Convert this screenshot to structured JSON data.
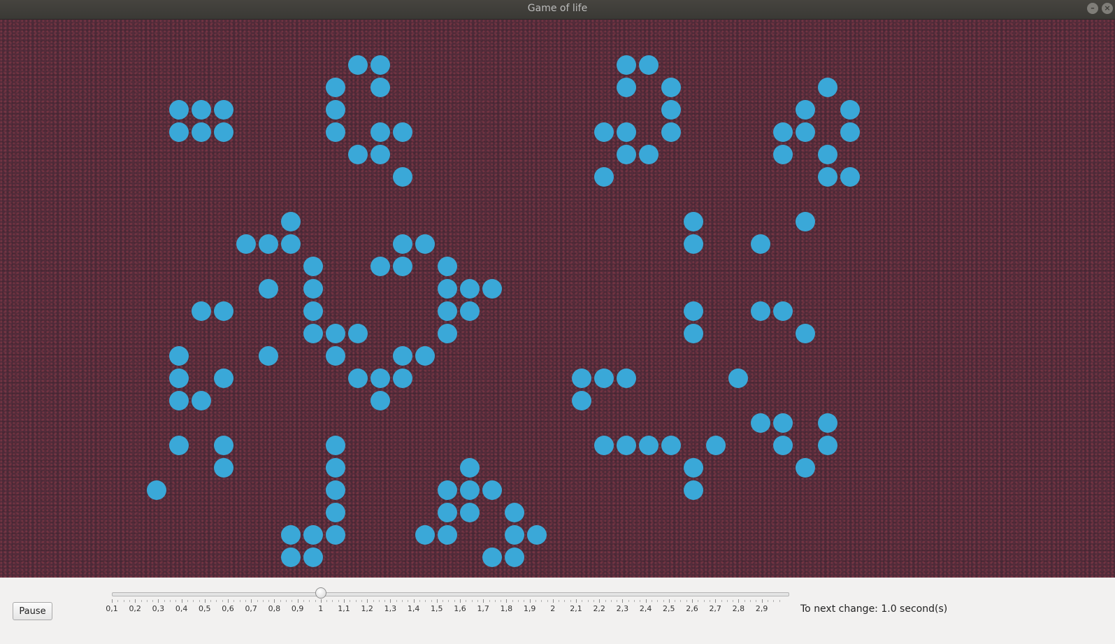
{
  "window": {
    "title": "Game of life"
  },
  "controls": {
    "pause_label": "Pause",
    "status_prefix": "To next change: ",
    "status_value": "1.0",
    "status_suffix": " second(s)"
  },
  "slider": {
    "min": 0.1,
    "max": 3.0,
    "value": 1.0,
    "tick_labels": [
      "0,1",
      "0,2",
      "0,3",
      "0,4",
      "0,5",
      "0,6",
      "0,7",
      "0,8",
      "0,9",
      "1",
      "1,1",
      "1,2",
      "1,3",
      "1,4",
      "1,5",
      "1,6",
      "1,7",
      "1,8",
      "1,9",
      "2",
      "2,1",
      "2,2",
      "2,3",
      "2,4",
      "2,5",
      "2,6",
      "2,7",
      "2,8",
      "2,9"
    ]
  },
  "board": {
    "cell_color": "#3aa8d8",
    "background_color": "#4d2a38",
    "live_cells": [
      [
        15,
        1
      ],
      [
        16,
        1
      ],
      [
        27,
        1
      ],
      [
        28,
        1
      ],
      [
        14,
        2
      ],
      [
        16,
        2
      ],
      [
        27,
        2
      ],
      [
        29,
        2
      ],
      [
        36,
        2
      ],
      [
        7,
        3
      ],
      [
        8,
        3
      ],
      [
        9,
        3
      ],
      [
        14,
        3
      ],
      [
        29,
        3
      ],
      [
        35,
        3
      ],
      [
        37,
        3
      ],
      [
        7,
        4
      ],
      [
        8,
        4
      ],
      [
        9,
        4
      ],
      [
        14,
        4
      ],
      [
        16,
        4
      ],
      [
        17,
        4
      ],
      [
        26,
        4
      ],
      [
        27,
        4
      ],
      [
        29,
        4
      ],
      [
        34,
        4
      ],
      [
        35,
        4
      ],
      [
        37,
        4
      ],
      [
        15,
        5
      ],
      [
        16,
        5
      ],
      [
        27,
        5
      ],
      [
        28,
        5
      ],
      [
        34,
        5
      ],
      [
        36,
        5
      ],
      [
        17,
        6
      ],
      [
        26,
        6
      ],
      [
        36,
        6
      ],
      [
        37,
        6
      ],
      [
        12,
        8
      ],
      [
        30,
        8
      ],
      [
        35,
        8
      ],
      [
        10,
        9
      ],
      [
        11,
        9
      ],
      [
        12,
        9
      ],
      [
        17,
        9
      ],
      [
        18,
        9
      ],
      [
        30,
        9
      ],
      [
        33,
        9
      ],
      [
        13,
        10
      ],
      [
        16,
        10
      ],
      [
        17,
        10
      ],
      [
        19,
        10
      ],
      [
        11,
        11
      ],
      [
        13,
        11
      ],
      [
        19,
        11
      ],
      [
        20,
        11
      ],
      [
        21,
        11
      ],
      [
        8,
        12
      ],
      [
        9,
        12
      ],
      [
        13,
        12
      ],
      [
        19,
        12
      ],
      [
        20,
        12
      ],
      [
        30,
        12
      ],
      [
        33,
        12
      ],
      [
        34,
        12
      ],
      [
        13,
        13
      ],
      [
        14,
        13
      ],
      [
        15,
        13
      ],
      [
        19,
        13
      ],
      [
        30,
        13
      ],
      [
        35,
        13
      ],
      [
        7,
        14
      ],
      [
        11,
        14
      ],
      [
        14,
        14
      ],
      [
        17,
        14
      ],
      [
        18,
        14
      ],
      [
        7,
        15
      ],
      [
        9,
        15
      ],
      [
        15,
        15
      ],
      [
        16,
        15
      ],
      [
        17,
        15
      ],
      [
        25,
        15
      ],
      [
        26,
        15
      ],
      [
        27,
        15
      ],
      [
        32,
        15
      ],
      [
        7,
        16
      ],
      [
        8,
        16
      ],
      [
        16,
        16
      ],
      [
        25,
        16
      ],
      [
        33,
        17
      ],
      [
        34,
        17
      ],
      [
        36,
        17
      ],
      [
        7,
        18
      ],
      [
        9,
        18
      ],
      [
        14,
        18
      ],
      [
        26,
        18
      ],
      [
        27,
        18
      ],
      [
        28,
        18
      ],
      [
        29,
        18
      ],
      [
        31,
        18
      ],
      [
        34,
        18
      ],
      [
        36,
        18
      ],
      [
        9,
        19
      ],
      [
        14,
        19
      ],
      [
        20,
        19
      ],
      [
        30,
        19
      ],
      [
        35,
        19
      ],
      [
        6,
        20
      ],
      [
        14,
        20
      ],
      [
        19,
        20
      ],
      [
        20,
        20
      ],
      [
        21,
        20
      ],
      [
        30,
        20
      ],
      [
        14,
        21
      ],
      [
        19,
        21
      ],
      [
        20,
        21
      ],
      [
        22,
        21
      ],
      [
        12,
        22
      ],
      [
        13,
        22
      ],
      [
        14,
        22
      ],
      [
        18,
        22
      ],
      [
        19,
        22
      ],
      [
        22,
        22
      ],
      [
        23,
        22
      ],
      [
        12,
        23
      ],
      [
        13,
        23
      ],
      [
        21,
        23
      ],
      [
        22,
        23
      ]
    ]
  }
}
